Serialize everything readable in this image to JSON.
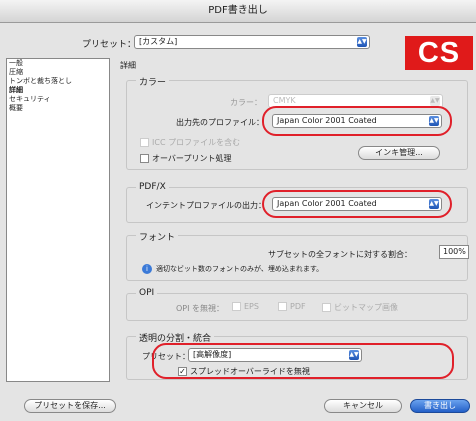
{
  "window": {
    "title": "PDF書き出し"
  },
  "badge": {
    "label": "CS"
  },
  "preset": {
    "label": "プリセット：",
    "value": "[カスタム]"
  },
  "sidebar": {
    "items": [
      {
        "label": "一般"
      },
      {
        "label": "圧縮"
      },
      {
        "label": "トンボと裁ち落とし"
      },
      {
        "label": "詳細"
      },
      {
        "label": "セキュリティ"
      },
      {
        "label": "概要"
      }
    ]
  },
  "detail": {
    "heading": "詳細"
  },
  "color": {
    "heading": "カラー",
    "color_label": "カラー：",
    "color_value": "CMYK",
    "dest_label": "出力先のプロファイル：",
    "dest_value": "Japan Color 2001 Coated",
    "icc_label": "ICC プロファイルを含む",
    "overprint_label": "オーバープリント処理",
    "ink_button": "インキ管理..."
  },
  "pdfx": {
    "heading": "PDF/X",
    "intent_label": "インテントプロファイルの出力：",
    "intent_value": "Japan Color 2001 Coated"
  },
  "font": {
    "heading": "フォント",
    "subset_label": "サブセットの全フォントに対する割合：",
    "subset_value": "100%",
    "info": "適切なビット数のフォントのみが、埋め込まれます。"
  },
  "opi": {
    "heading": "OPI",
    "ignore_label": "OPI を無視：",
    "eps_label": "EPS",
    "pdf_label": "PDF",
    "bitmap_label": "ビットマップ画像"
  },
  "transparency": {
    "heading": "透明の分割・統合",
    "preset_label": "プリセット：",
    "preset_value": "[高解像度]",
    "spread_label": "スプレッドオーバーライドを無視"
  },
  "footer": {
    "save_preset": "プリセットを保存...",
    "cancel": "キャンセル",
    "export": "書き出し"
  },
  "colors": {
    "highlight": "#e0202a",
    "badge": "#e01a1a",
    "accent": "#2360c8"
  }
}
